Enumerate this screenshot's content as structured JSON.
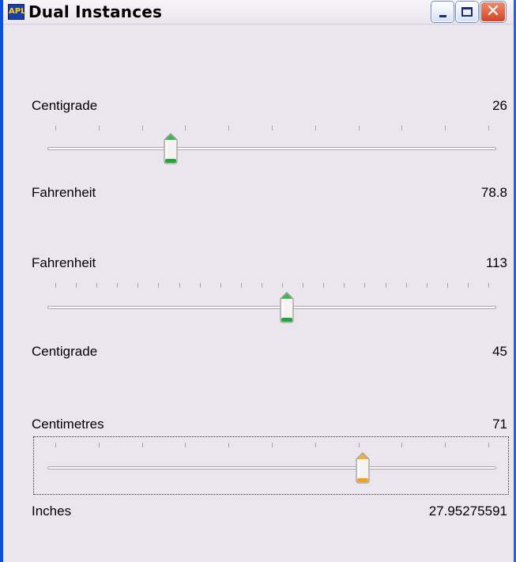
{
  "window": {
    "title": "Dual Instances",
    "icon_name": "app-icon",
    "icon_text": "APL",
    "buttons": {
      "minimize_icon": "minimize-icon",
      "maximize_icon": "maximize-icon",
      "close_icon": "close-icon"
    }
  },
  "sliders": [
    {
      "label": "Centigrade",
      "value": "26",
      "converted_label": "Fahrenheit",
      "converted_value": "78.8",
      "position": 0.267,
      "tick_count": 11,
      "thumb_color": "#1ea73a",
      "focused": false
    },
    {
      "label": "Fahrenheit",
      "value": "113",
      "converted_label": "Centigrade",
      "converted_value": "45",
      "position": 0.534,
      "tick_count": 22,
      "thumb_color": "#1ea73a",
      "focused": false
    },
    {
      "label": "Centimetres",
      "value": "71",
      "converted_label": "Inches",
      "converted_value": "27.95275591",
      "position": 0.71,
      "tick_count": 11,
      "thumb_color": "#f0a21e",
      "focused": true
    }
  ]
}
